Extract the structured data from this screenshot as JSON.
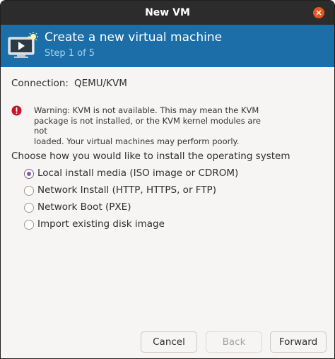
{
  "window": {
    "title": "New VM"
  },
  "header": {
    "title": "Create a new virtual machine",
    "step": "Step 1 of 5"
  },
  "connection": {
    "label": "Connection:",
    "value": "QEMU/KVM"
  },
  "warning": {
    "line1": "Warning: KVM is not available. This may mean the KVM",
    "line2": "package is not installed, or the KVM kernel modules are not",
    "line3": "loaded. Your virtual machines may perform poorly."
  },
  "install": {
    "prompt": "Choose how you would like to install the operating system",
    "options": [
      {
        "label": "Local install media (ISO image or CDROM)",
        "selected": true
      },
      {
        "label": "Network Install (HTTP, HTTPS, or FTP)",
        "selected": false
      },
      {
        "label": "Network Boot (PXE)",
        "selected": false
      },
      {
        "label": "Import existing disk image",
        "selected": false
      }
    ]
  },
  "buttons": {
    "cancel": "Cancel",
    "back": "Back",
    "forward": "Forward"
  },
  "colors": {
    "titlebar": "#2c2c2c",
    "header": "#1b6ea8",
    "close": "#e95420",
    "radio_selected": "#8a5a9e",
    "warning_icon": "#c7162b"
  },
  "icons": {
    "close": "close-icon",
    "vm": "virtual-machine-icon",
    "warning": "error-icon"
  }
}
